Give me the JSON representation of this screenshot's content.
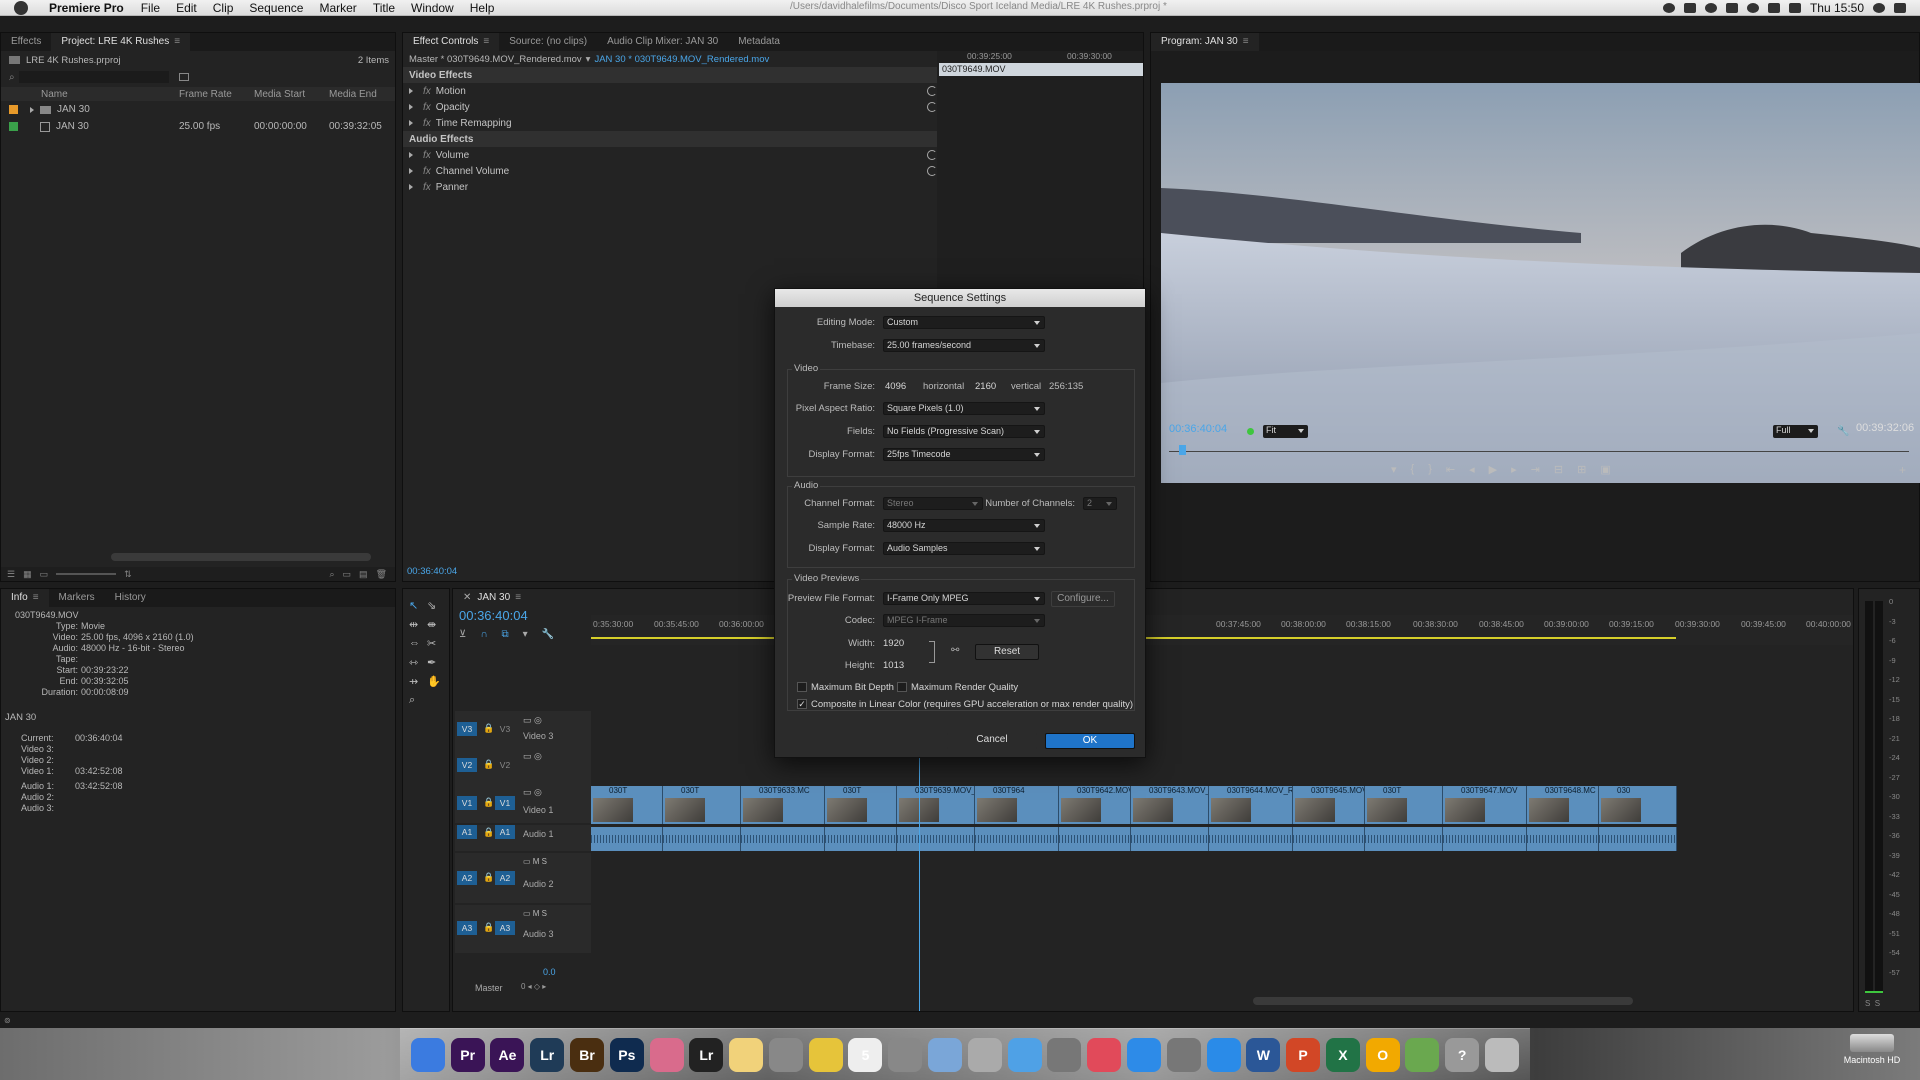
{
  "menubar": {
    "app": "Premiere Pro",
    "items": [
      "File",
      "Edit",
      "Clip",
      "Sequence",
      "Marker",
      "Title",
      "Window",
      "Help"
    ],
    "path": "/Users/davidhalefilms/Documents/Disco Sport Iceland Media/LRE 4K Rushes.prproj *",
    "clock": "Thu 15:50"
  },
  "project": {
    "tabs": [
      "Effects",
      "Project: LRE 4K Rushes"
    ],
    "file": "LRE 4K Rushes.prproj",
    "count": "2 Items",
    "columns": [
      "Name",
      "Frame Rate",
      "Media Start",
      "Media End"
    ],
    "rows": [
      {
        "name": "JAN 30",
        "rate": "",
        "start": "",
        "end": "",
        "color": "#e89a2a"
      },
      {
        "name": "JAN 30",
        "rate": "25.00 fps",
        "start": "00:00:00:00",
        "end": "00:39:32:05",
        "color": "#3aa04a"
      }
    ]
  },
  "effectControls": {
    "tabs": [
      "Effect Controls",
      "Source: (no clips)",
      "Audio Clip Mixer: JAN 30",
      "Metadata"
    ],
    "master": "Master * 030T9649.MOV_Rendered.mov",
    "seq": "JAN 30 * 030T9649.MOV_Rendered.mov",
    "ruler": [
      "00:39:25:00",
      "00:39:30:00"
    ],
    "clipname": "030T9649.MOV",
    "videoHdr": "Video Effects",
    "audioHdr": "Audio Effects",
    "video": [
      "Motion",
      "Opacity",
      "Time Remapping"
    ],
    "audio": [
      "Volume",
      "Channel Volume",
      "Panner"
    ],
    "timecode": "00:36:40:04"
  },
  "program": {
    "tab": "Program: JAN 30",
    "timecode": "00:36:40:04",
    "fit": "Fit",
    "res": "Full",
    "duration": "00:39:32:06"
  },
  "dialog": {
    "title": "Sequence Settings",
    "editingMode": {
      "label": "Editing Mode:",
      "value": "Custom"
    },
    "timebase": {
      "label": "Timebase:",
      "value": "25.00 frames/second"
    },
    "video": "Video",
    "frameSize": {
      "label": "Frame Size:",
      "w": "4096",
      "h_label": "horizontal",
      "h": "2160",
      "v_label": "vertical",
      "ratio": "256:135"
    },
    "par": {
      "label": "Pixel Aspect Ratio:",
      "value": "Square Pixels (1.0)"
    },
    "fields": {
      "label": "Fields:",
      "value": "No Fields (Progressive Scan)"
    },
    "displayFormat": {
      "label": "Display Format:",
      "value": "25fps Timecode"
    },
    "audio": "Audio",
    "channelFormat": {
      "label": "Channel Format:",
      "value": "Stereo"
    },
    "channels": {
      "label": "Number of Channels:",
      "value": "2"
    },
    "sampleRate": {
      "label": "Sample Rate:",
      "value": "48000 Hz"
    },
    "audioDisplay": {
      "label": "Display Format:",
      "value": "Audio Samples"
    },
    "previews": "Video Previews",
    "previewFormat": {
      "label": "Preview File Format:",
      "value": "I-Frame Only MPEG"
    },
    "configure": "Configure...",
    "codec": {
      "label": "Codec:",
      "value": "MPEG I-Frame"
    },
    "width": {
      "label": "Width:",
      "value": "1920"
    },
    "height": {
      "label": "Height:",
      "value": "1013"
    },
    "reset": "Reset",
    "maxBit": "Maximum Bit Depth",
    "maxRender": "Maximum Render Quality",
    "linear": "Composite in Linear Color (requires GPU acceleration or max render quality)",
    "cancel": "Cancel",
    "ok": "OK"
  },
  "info": {
    "tabs": [
      "Info",
      "Markers",
      "History"
    ],
    "clip": "030T9649.MOV",
    "lines": [
      [
        "Type:",
        "Movie"
      ],
      [
        "Video:",
        "25.00 fps, 4096 x 2160 (1.0)"
      ],
      [
        "Audio:",
        "48000 Hz - 16-bit - Stereo"
      ],
      [
        "Tape:",
        ""
      ],
      [
        "Start:",
        "00:39:23:22"
      ],
      [
        "End:",
        "00:39:32:05"
      ],
      [
        "Duration:",
        "00:00:08:09"
      ]
    ],
    "seq": "JAN 30",
    "seqLines": [
      [
        "Current:",
        "00:36:40:04"
      ],
      [
        "Video 3:",
        ""
      ],
      [
        "Video 2:",
        ""
      ],
      [
        "Video 1:",
        "03:42:52:08"
      ],
      [
        "Audio 1:",
        "03:42:52:08"
      ],
      [
        "Audio 2:",
        ""
      ],
      [
        "Audio 3:",
        ""
      ]
    ]
  },
  "timeline": {
    "tab": "JAN 30",
    "timecode": "00:36:40:04",
    "ruler": [
      "0:35:30:00",
      "00:35:45:00",
      "00:36:00:00",
      "00:37:45:00",
      "00:38:00:00",
      "00:38:15:00",
      "00:38:30:00",
      "00:38:45:00",
      "00:39:00:00",
      "00:39:15:00",
      "00:39:30:00",
      "00:39:45:00",
      "00:40:00:00"
    ],
    "tracks": [
      {
        "id": "V3",
        "name": "Video 3"
      },
      {
        "id": "V2",
        "name": ""
      },
      {
        "id": "V1",
        "name": "Video 1"
      },
      {
        "id": "A1",
        "name": "Audio 1"
      },
      {
        "id": "A2",
        "name": "Audio 2"
      },
      {
        "id": "A3",
        "name": "Audio 3"
      }
    ],
    "clips": [
      "030T",
      "030T",
      "030T9633.MC",
      "030T",
      "030T9639.MOV_Rend",
      "030T964",
      "030T9642.MOV",
      "030T9643.MOV_I",
      "030T9644.MOV_R",
      "030T9645.MOV",
      "030T",
      "030T9647.MOV",
      "030T9648.MC",
      "030"
    ],
    "master": "Master",
    "masterVal": "0.0"
  },
  "meters": [
    "0",
    "-3",
    "-6",
    "-9",
    "-12",
    "-15",
    "-18",
    "-21",
    "-24",
    "-27",
    "-30",
    "-33",
    "-36",
    "-39",
    "-42",
    "-45",
    "-48",
    "-51",
    "-54",
    "-57"
  ],
  "dock": [
    "Finder",
    "Pr",
    "Ae",
    "Lr",
    "Br",
    "Ps",
    "Photos",
    "Lr",
    "Notes",
    "Pref",
    "Yellow",
    "5",
    "Launchpad",
    "Preview",
    "Files",
    "Scan",
    "Automator",
    "Music",
    "App Store",
    "Settings",
    "Safari",
    "W",
    "P",
    "X",
    "O",
    "Teams",
    "?",
    "Trash"
  ],
  "disk": "Macintosh HD"
}
